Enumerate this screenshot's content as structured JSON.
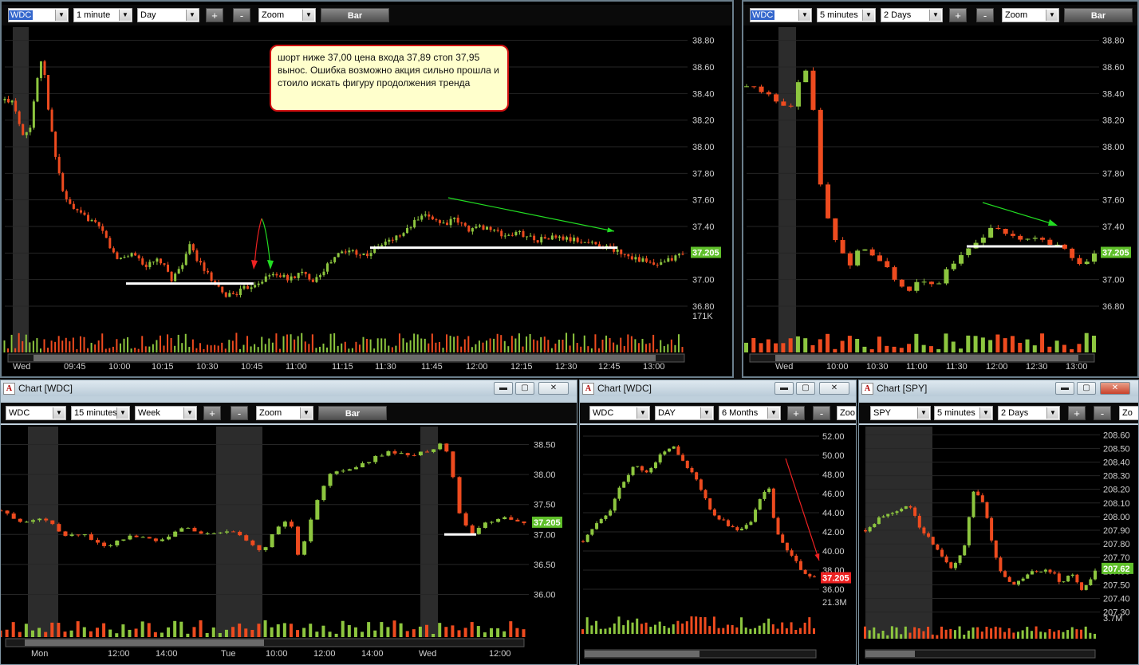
{
  "controls": {
    "zoom_label": "Zoom",
    "bar_label": "Bar",
    "plus_label": "+",
    "minus_label": "-",
    "minimize_glyph": "▬",
    "restore_glyph": "▢",
    "close_glyph": "✕",
    "dropdown_glyph": "▼"
  },
  "colors": {
    "up": "#8dc63f",
    "down": "#ee4b1f",
    "grid": "#262626",
    "axis": "#d0d0d0",
    "session": "#2c2c2c"
  },
  "panels": [
    {
      "id": "p1",
      "symbol": "WDC",
      "interval": "1 minute",
      "range": "Day",
      "annotation": "шорт ниже 37,00 цена входа 37,89 стоп 37,95 вынос. Ошибка возможно акция сильно прошла и стоило искать фигуру продолжения тренда",
      "price_ticks": [
        "38.80",
        "38.60",
        "38.40",
        "38.20",
        "38.00",
        "37.80",
        "37.60",
        "37.40",
        "37.20",
        "37.00",
        "36.80"
      ],
      "volume_label": "171K",
      "last_price": "37.205",
      "time_labels": [
        "Wed",
        "09:45",
        "10:00",
        "10:15",
        "10:30",
        "10:45",
        "11:00",
        "11:15",
        "11:30",
        "11:45",
        "12:00",
        "12:15",
        "12:30",
        "12:45",
        "13:00"
      ]
    },
    {
      "id": "p2",
      "symbol": "WDC",
      "interval": "5 minutes",
      "range": "2 Days",
      "price_ticks": [
        "38.80",
        "38.60",
        "38.40",
        "38.20",
        "38.00",
        "37.80",
        "37.60",
        "37.40",
        "37.20",
        "37.00",
        "36.80"
      ],
      "last_price": "37.205",
      "time_labels": [
        "Wed",
        "10:00",
        "10:30",
        "11:00",
        "11:30",
        "12:00",
        "12:30",
        "13:00"
      ]
    },
    {
      "id": "p3",
      "title": "Chart [WDC]",
      "symbol": "WDC",
      "interval": "15 minutes",
      "range": "Week",
      "price_ticks": [
        "38.50",
        "38.00",
        "37.50",
        "37.00",
        "36.50",
        "36.00"
      ],
      "last_price": "37.205",
      "time_labels": [
        "Mon",
        "12:00",
        "14:00",
        "Tue",
        "10:00",
        "12:00",
        "14:00",
        "Wed",
        "12:00"
      ]
    },
    {
      "id": "p4",
      "title": "Chart [WDC]",
      "symbol": "WDC",
      "interval": "DAY",
      "range": "6 Months",
      "zoom_partial": "Zoo",
      "price_ticks": [
        "52.00",
        "50.00",
        "48.00",
        "46.00",
        "44.00",
        "42.00",
        "40.00",
        "38.00",
        "36.00"
      ],
      "volume_label": "21.3M",
      "last_price": "37.205"
    },
    {
      "id": "p5",
      "title": "Chart [SPY]",
      "symbol": "SPY",
      "interval": "5 minutes",
      "range": "2 Days",
      "zoom_partial": "Zo",
      "price_ticks": [
        "208.60",
        "208.50",
        "208.40",
        "208.30",
        "208.20",
        "208.10",
        "208.00",
        "207.90",
        "207.80",
        "207.70",
        "207.60",
        "207.50",
        "207.40",
        "207.30"
      ],
      "volume_label": "3.7M",
      "last_price": "207.62"
    }
  ],
  "chart_data": [
    {
      "type": "candlestick",
      "panel": "p1",
      "ylim": [
        36.74,
        38.9
      ],
      "x_range": [
        "09:30",
        "13:08"
      ],
      "path": [
        [
          0,
          38.35
        ],
        [
          2,
          38.35
        ],
        [
          4,
          38.1
        ],
        [
          6,
          38.15
        ],
        [
          7,
          38.4
        ],
        [
          8,
          38.6
        ],
        [
          9,
          38.65
        ],
        [
          10,
          38.3
        ],
        [
          12,
          37.9
        ],
        [
          14,
          37.6
        ],
        [
          17,
          37.5
        ],
        [
          20,
          37.45
        ],
        [
          23,
          37.35
        ],
        [
          26,
          37.15
        ],
        [
          30,
          37.2
        ],
        [
          33,
          37.1
        ],
        [
          36,
          37.15
        ],
        [
          39,
          37.0
        ],
        [
          41,
          37.1
        ],
        [
          43,
          37.25
        ],
        [
          45,
          37.15
        ],
        [
          48,
          37.0
        ],
        [
          51,
          36.88
        ],
        [
          54,
          36.9
        ],
        [
          57,
          36.95
        ],
        [
          60,
          37.0
        ],
        [
          63,
          37.05
        ],
        [
          66,
          37.0
        ],
        [
          69,
          37.05
        ],
        [
          72,
          37.0
        ],
        [
          75,
          37.1
        ],
        [
          78,
          37.2
        ],
        [
          81,
          37.22
        ],
        [
          84,
          37.18
        ],
        [
          87,
          37.25
        ],
        [
          90,
          37.3
        ],
        [
          93,
          37.35
        ],
        [
          96,
          37.45
        ],
        [
          99,
          37.48
        ],
        [
          102,
          37.42
        ],
        [
          105,
          37.45
        ],
        [
          108,
          37.38
        ],
        [
          112,
          37.4
        ],
        [
          116,
          37.33
        ],
        [
          120,
          37.35
        ],
        [
          124,
          37.3
        ],
        [
          128,
          37.32
        ],
        [
          132,
          37.3
        ],
        [
          136,
          37.28
        ],
        [
          140,
          37.25
        ],
        [
          144,
          37.2
        ],
        [
          148,
          37.15
        ],
        [
          152,
          37.1
        ],
        [
          155,
          37.15
        ],
        [
          158,
          37.2
        ]
      ],
      "levels": [
        {
          "from": "10:20",
          "to": "10:53",
          "y": 36.97
        },
        {
          "from": "11:25",
          "to": "12:50",
          "y": 37.24
        }
      ],
      "trend_arrow": {
        "from": [
          "11:45",
          37.55
        ],
        "to": [
          "12:45",
          37.28
        ]
      }
    },
    {
      "type": "candlestick",
      "panel": "p2",
      "ylim": [
        36.74,
        38.9
      ],
      "x_range": [
        "09:20",
        "13:10"
      ],
      "path": [
        [
          0,
          38.45
        ],
        [
          2,
          38.42
        ],
        [
          4,
          38.35
        ],
        [
          6,
          38.3
        ],
        [
          8,
          38.6
        ],
        [
          9,
          38.4
        ],
        [
          10,
          37.8
        ],
        [
          11,
          37.5
        ],
        [
          12,
          37.35
        ],
        [
          14,
          37.1
        ],
        [
          16,
          37.25
        ],
        [
          18,
          37.15
        ],
        [
          20,
          37.05
        ],
        [
          22,
          36.88
        ],
        [
          24,
          37.0
        ],
        [
          26,
          36.95
        ],
        [
          28,
          37.1
        ],
        [
          30,
          37.2
        ],
        [
          32,
          37.3
        ],
        [
          34,
          37.4
        ],
        [
          36,
          37.35
        ],
        [
          38,
          37.3
        ],
        [
          40,
          37.3
        ],
        [
          42,
          37.28
        ],
        [
          44,
          37.25
        ],
        [
          46,
          37.1
        ],
        [
          48,
          37.2
        ]
      ],
      "levels": [
        {
          "from": "11:33",
          "to": "12:35",
          "y": 37.25
        }
      ]
    },
    {
      "type": "candlestick",
      "panel": "p3",
      "ylim": [
        35.9,
        38.8
      ],
      "path": [
        [
          0,
          37.4
        ],
        [
          4,
          37.2
        ],
        [
          8,
          37.3
        ],
        [
          12,
          37.0
        ],
        [
          16,
          37.0
        ],
        [
          20,
          36.8
        ],
        [
          25,
          37.0
        ],
        [
          30,
          36.9
        ],
        [
          35,
          37.1
        ],
        [
          40,
          37.0
        ],
        [
          45,
          37.05
        ],
        [
          50,
          36.7
        ],
        [
          52,
          37.0
        ],
        [
          55,
          37.3
        ],
        [
          57,
          36.6
        ],
        [
          60,
          37.5
        ],
        [
          63,
          38.0
        ],
        [
          66,
          38.1
        ],
        [
          70,
          38.2
        ],
        [
          74,
          38.4
        ],
        [
          78,
          38.3
        ],
        [
          82,
          38.4
        ],
        [
          84,
          38.5
        ],
        [
          86,
          38.3
        ],
        [
          87,
          37.5
        ],
        [
          88,
          37.3
        ],
        [
          90,
          37.0
        ],
        [
          93,
          37.2
        ],
        [
          96,
          37.3
        ],
        [
          100,
          37.2
        ]
      ],
      "levels": [
        {
          "from": "Wed 11:00",
          "to": "Wed 12:00",
          "y": 37.0
        }
      ]
    },
    {
      "type": "candlestick",
      "panel": "p4",
      "ylim": [
        35.0,
        53.0
      ],
      "path": [
        [
          0,
          41
        ],
        [
          5,
          43
        ],
        [
          10,
          44
        ],
        [
          15,
          47
        ],
        [
          20,
          49
        ],
        [
          25,
          48
        ],
        [
          30,
          50
        ],
        [
          35,
          51
        ],
        [
          40,
          49
        ],
        [
          45,
          47
        ],
        [
          50,
          44
        ],
        [
          55,
          43
        ],
        [
          60,
          42
        ],
        [
          65,
          43
        ],
        [
          70,
          46
        ],
        [
          72,
          47
        ],
        [
          75,
          42
        ],
        [
          80,
          40
        ],
        [
          85,
          38
        ],
        [
          90,
          37.2
        ]
      ],
      "trend_arrow": {
        "from": [
          66,
          48
        ],
        "to": [
          90,
          37.5
        ]
      }
    },
    {
      "type": "candlestick",
      "panel": "p5",
      "ylim": [
        207.28,
        208.66
      ],
      "path": [
        [
          0,
          207.9
        ],
        [
          5,
          208.0
        ],
        [
          10,
          208.05
        ],
        [
          14,
          208.1
        ],
        [
          18,
          207.9
        ],
        [
          22,
          207.8
        ],
        [
          25,
          207.7
        ],
        [
          28,
          207.6
        ],
        [
          32,
          207.8
        ],
        [
          35,
          208.2
        ],
        [
          38,
          208.1
        ],
        [
          40,
          207.9
        ],
        [
          43,
          207.6
        ],
        [
          47,
          207.5
        ],
        [
          50,
          207.55
        ],
        [
          55,
          207.6
        ],
        [
          60,
          207.6
        ],
        [
          63,
          207.5
        ],
        [
          66,
          207.6
        ],
        [
          70,
          207.45
        ],
        [
          74,
          207.6
        ]
      ]
    }
  ]
}
